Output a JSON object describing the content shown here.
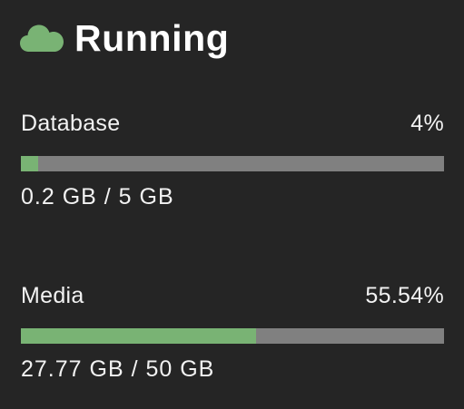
{
  "header": {
    "icon": "cloud-icon",
    "status": "Running"
  },
  "metrics": [
    {
      "label": "Database",
      "percent_text": "4%",
      "fraction": 0.04,
      "usage": "0.2 GB / 5 GB"
    },
    {
      "label": "Media",
      "percent_text": "55.54%",
      "fraction": 0.5554,
      "usage": "27.77 GB / 50 GB"
    }
  ],
  "colors": {
    "background": "#252525",
    "accent": "#79b374",
    "track": "#808080",
    "text": "#f2f2f2"
  }
}
